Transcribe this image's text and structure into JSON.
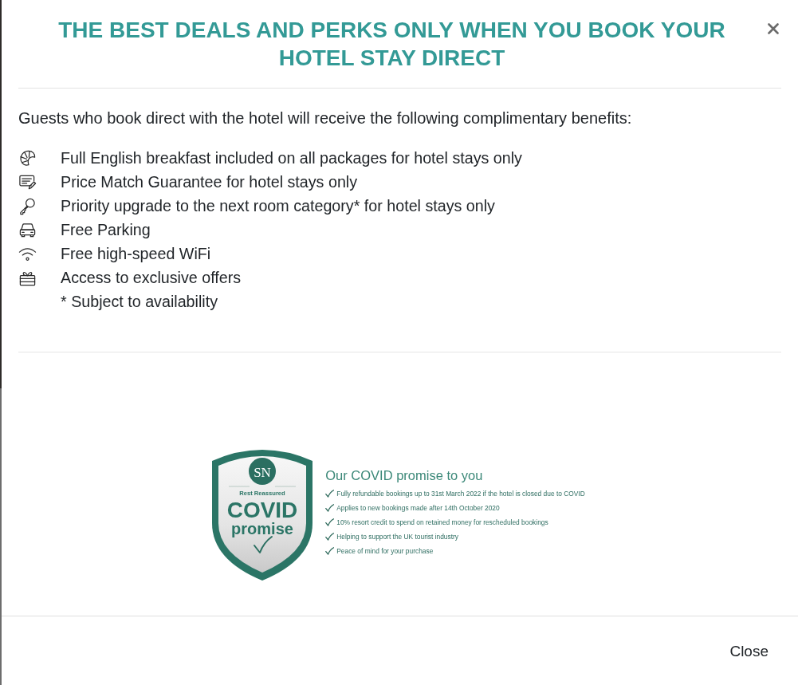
{
  "dialog": {
    "title": "THE BEST DEALS AND PERKS ONLY WHEN YOU BOOK YOUR HOTEL STAY DIRECT"
  },
  "intro": "Guests who book direct with the hotel will receive the following complimentary benefits:",
  "benefits": [
    {
      "kind": "breakfast",
      "text": "Full English breakfast included on all packages for hotel stays only"
    },
    {
      "kind": "price",
      "text": "Price Match Guarantee for hotel stays only"
    },
    {
      "kind": "upgrade",
      "text": "Priority upgrade to the next room category* for hotel stays only"
    },
    {
      "kind": "parking",
      "text": "Free Parking"
    },
    {
      "kind": "wifi",
      "text": "Free high-speed WiFi"
    },
    {
      "kind": "offers",
      "text": "Access to exclusive offers"
    }
  ],
  "footnote": "* Subject to availability",
  "covid_promise": {
    "badge": {
      "monogram": "SN",
      "tagline": "Rest Reassured",
      "word_1": "COVID",
      "word_2": "promise"
    },
    "heading": "Our COVID promise to you",
    "points": [
      "Fully refundable bookings up to 31st March 2022 if the hotel is closed due to COVID",
      "Applies to new bookings made after 14th October 2020",
      "10% resort credit to spend on retained money for rescheduled bookings",
      "Helping to support the UK tourist industry",
      "Peace of mind for your purchase"
    ]
  },
  "footer": {
    "button": "Close"
  }
}
